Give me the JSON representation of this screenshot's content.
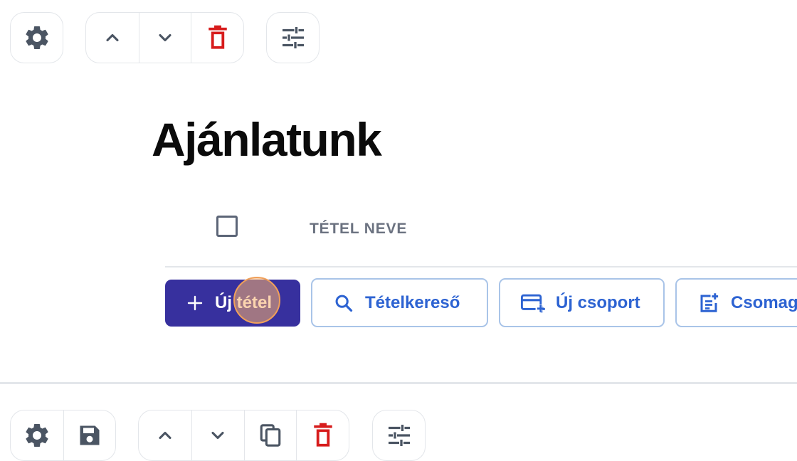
{
  "top_toolbar": {
    "icons": [
      "gear-icon",
      "chevron-up-icon",
      "chevron-down-icon",
      "trash-icon",
      "sliders-icon"
    ]
  },
  "heading": {
    "title": "Ajánlatunk"
  },
  "table": {
    "column_header": "TÉTEL NEVE"
  },
  "actions": {
    "new_item": "Új tétel",
    "item_search": "Tételkereső",
    "new_group": "Új csoport",
    "package": "Csomag"
  },
  "bottom_toolbar": {
    "icons": [
      "gear-icon",
      "save-icon",
      "chevron-up-icon",
      "chevron-down-icon",
      "copy-icon",
      "trash-icon",
      "sliders-icon"
    ]
  },
  "colors": {
    "primary": "#37309e",
    "link": "#2d63d2",
    "danger": "#d71c1c",
    "icon": "#4b5563",
    "border": "#e3e6ea"
  }
}
